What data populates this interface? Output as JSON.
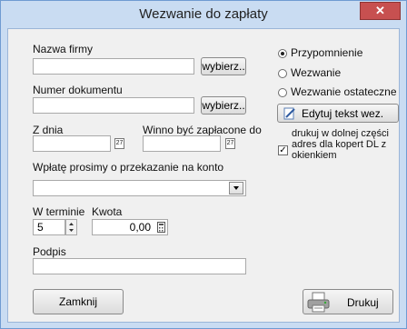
{
  "window": {
    "title": "Wezwanie do zapłaty",
    "close_glyph": "✕"
  },
  "form": {
    "company_label": "Nazwa firmy",
    "company_value": "",
    "company_pick": "wybierz..",
    "docnum_label": "Numer dokumentu",
    "docnum_value": "",
    "docnum_pick": "wybierz..",
    "date_label": "Z dnia",
    "date_value": "",
    "due_label": "Winno być zapłacone do",
    "due_value": "",
    "calendar_glyph": "27",
    "account_label": "Wpłatę prosimy o przekazanie na konto",
    "account_value": "",
    "term_label": "W terminie",
    "term_value": "5",
    "amount_label": "Kwota",
    "amount_value": "0,00",
    "signature_label": "Podpis",
    "signature_value": ""
  },
  "options": {
    "radio_items": [
      {
        "label": "Przypomnienie",
        "checked": true
      },
      {
        "label": "Wezwanie",
        "checked": false
      },
      {
        "label": "Wezwanie ostateczne",
        "checked": false
      }
    ],
    "edit_button": "Edytuj tekst wez.",
    "checkbox_label": "drukuj w dolnej części adres dla kopert DL z okienkiem",
    "checkbox_checked": true
  },
  "buttons": {
    "close": "Zamknij",
    "print": "Drukuj"
  }
}
